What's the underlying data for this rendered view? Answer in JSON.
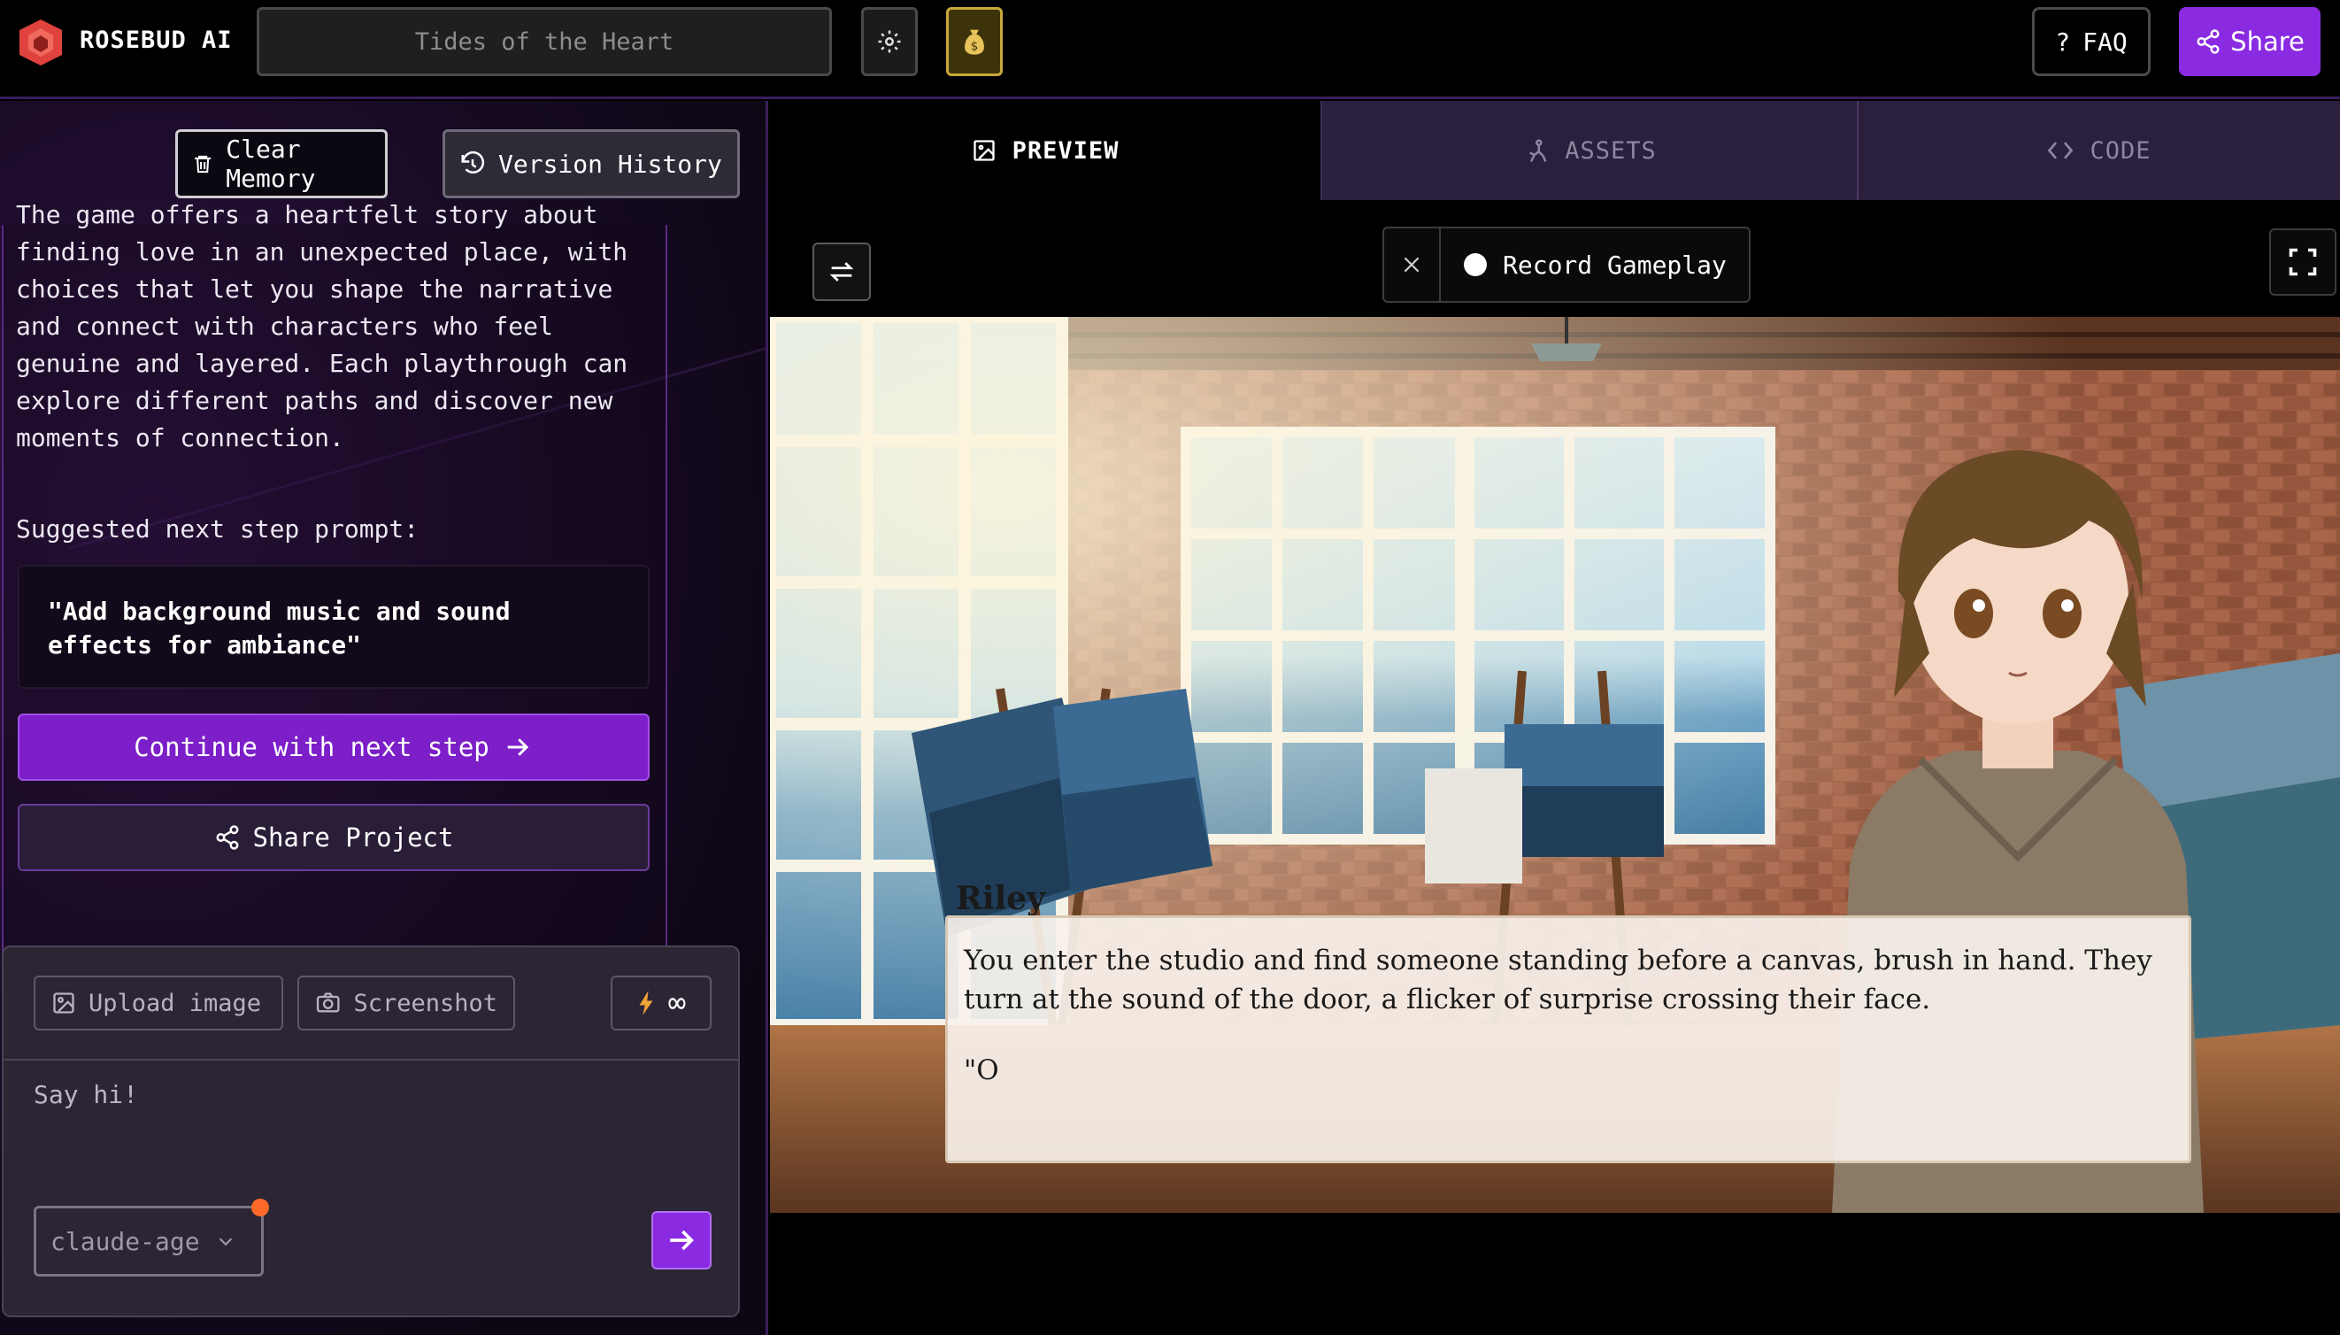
{
  "header": {
    "brand": "ROSEBUD AI",
    "project_title": "Tides of the Heart",
    "faq_label": "FAQ",
    "faq_prefix": "?",
    "share_label": "Share"
  },
  "sidebar": {
    "clear_memory": "Clear Memory",
    "version_history": "Version History",
    "message": "The game offers a heartfelt story about finding love in an unexpected place, with choices that let you shape the narrative and connect with characters who feel genuine and layered. Each playthrough can explore different paths and discover new moments of connection.",
    "suggested_label": "Suggested next step prompt:",
    "suggested_prompt": "\"Add background music and sound effects for ambiance\"",
    "continue_label": "Continue with next step",
    "share_project_label": "Share Project"
  },
  "composer": {
    "upload_label": "Upload image",
    "screenshot_label": "Screenshot",
    "credits_value": "∞",
    "placeholder": "Say hi!",
    "model_value": "claude-age"
  },
  "tabs": [
    {
      "label": "PREVIEW",
      "active": true
    },
    {
      "label": "ASSETS",
      "active": false
    },
    {
      "label": "CODE",
      "active": false
    }
  ],
  "preview": {
    "record_label": "Record Gameplay",
    "speaker": "Riley",
    "dialog_text": "You enter the studio and find someone standing before a canvas, brush in hand. They turn at the sound of the door, a flicker of surprise crossing their face.",
    "dialog_partial": "\"O"
  },
  "colors": {
    "accent": "#8a2be2",
    "logo": "#e0433d",
    "money": "#c9a73a",
    "notify": "#ff6a2a"
  }
}
